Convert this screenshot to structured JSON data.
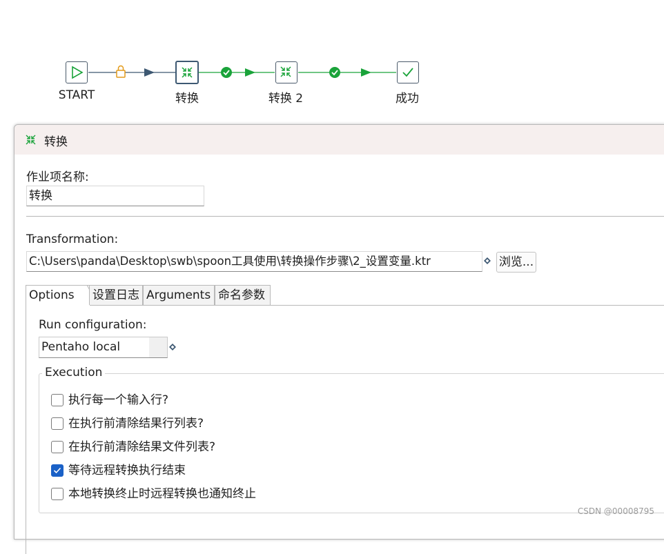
{
  "workflow": {
    "nodes": [
      {
        "label": "START",
        "icon": "start-icon"
      },
      {
        "label": "转换",
        "icon": "transformation-icon",
        "selected": true
      },
      {
        "label": "转换 2",
        "icon": "transformation-icon"
      },
      {
        "label": "成功",
        "icon": "success-icon"
      }
    ],
    "hops": [
      {
        "from": "START",
        "to": "转换",
        "status": "unconditional-lock-icon"
      },
      {
        "from": "转换",
        "to": "转换 2",
        "status": "success-check-icon"
      },
      {
        "from": "转换 2",
        "to": "成功",
        "status": "success-check-icon"
      }
    ]
  },
  "dialog": {
    "title": "转换",
    "job_entry_name_label": "作业项名称:",
    "job_entry_name_value": "转换",
    "transformation_label": "Transformation:",
    "transformation_path": "C:\\Users\\panda\\Desktop\\swb\\spoon工具使用\\转换操作步骤\\2_设置变量.ktr",
    "browse_button": "浏览...",
    "tabs": [
      "Options",
      "设置日志",
      "Arguments",
      "命名参数"
    ],
    "active_tab": "Options",
    "options": {
      "run_config_label": "Run configuration:",
      "run_config_value": "Pentaho local",
      "execution_legend": "Execution",
      "checkboxes": [
        {
          "label": "执行每一个输入行?",
          "checked": false
        },
        {
          "label": "在执行前清除结果行列表?",
          "checked": false
        },
        {
          "label": "在执行前清除结果文件列表?",
          "checked": false
        },
        {
          "label": "等待远程转换执行结束",
          "checked": true
        },
        {
          "label": "本地转换终止时远程转换也通知终止",
          "checked": false
        }
      ]
    }
  },
  "watermark": "CSDN @00008795",
  "colors": {
    "hop_blue": "#3d5872",
    "hop_green": "#1aa33a",
    "lock_orange": "#e39a1a",
    "checkbox_blue": "#1a61c7",
    "title_bar": "#f6efee"
  }
}
